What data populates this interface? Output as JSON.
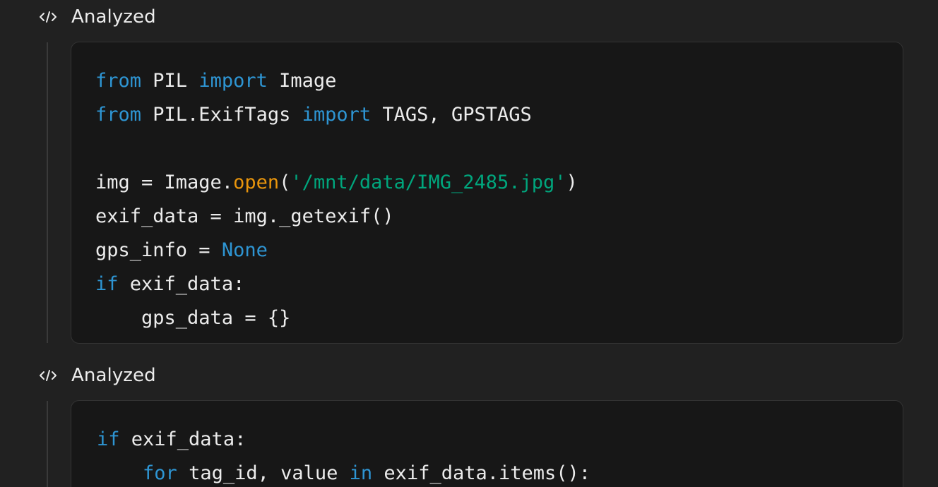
{
  "blocks": [
    {
      "status_label": "Analyzed",
      "icon": "code-icon",
      "lines": [
        [
          {
            "t": "kw",
            "v": "from"
          },
          {
            "t": "plain",
            "v": " PIL "
          },
          {
            "t": "kw",
            "v": "import"
          },
          {
            "t": "plain",
            "v": " Image"
          }
        ],
        [
          {
            "t": "kw",
            "v": "from"
          },
          {
            "t": "plain",
            "v": " PIL.ExifTags "
          },
          {
            "t": "kw",
            "v": "import"
          },
          {
            "t": "plain",
            "v": " TAGS, GPSTAGS"
          }
        ],
        [],
        [
          {
            "t": "plain",
            "v": "img = Image."
          },
          {
            "t": "fn",
            "v": "open"
          },
          {
            "t": "plain",
            "v": "("
          },
          {
            "t": "str",
            "v": "'/mnt/data/IMG_2485.jpg'"
          },
          {
            "t": "plain",
            "v": ")"
          }
        ],
        [
          {
            "t": "plain",
            "v": "exif_data = img._getexif()"
          }
        ],
        [
          {
            "t": "plain",
            "v": "gps_info = "
          },
          {
            "t": "kw",
            "v": "None"
          }
        ],
        [
          {
            "t": "kw",
            "v": "if"
          },
          {
            "t": "plain",
            "v": " exif_data:"
          }
        ],
        [
          {
            "t": "plain",
            "v": "    gps_data = {}"
          }
        ]
      ]
    },
    {
      "status_label": "Analyzed",
      "icon": "code-icon",
      "lines": [
        [
          {
            "t": "kw",
            "v": "if"
          },
          {
            "t": "plain",
            "v": " exif_data:"
          }
        ],
        [
          {
            "t": "plain",
            "v": "    "
          },
          {
            "t": "kw",
            "v": "for"
          },
          {
            "t": "plain",
            "v": " tag_id, value "
          },
          {
            "t": "kw",
            "v": "in"
          },
          {
            "t": "plain",
            "v": " exif_data.items():"
          }
        ]
      ]
    }
  ],
  "colors": {
    "background": "#212121",
    "code_background": "#171717",
    "keyword": "#2e95d3",
    "function": "#e9950c",
    "string": "#00a67d",
    "text": "#ececec"
  }
}
